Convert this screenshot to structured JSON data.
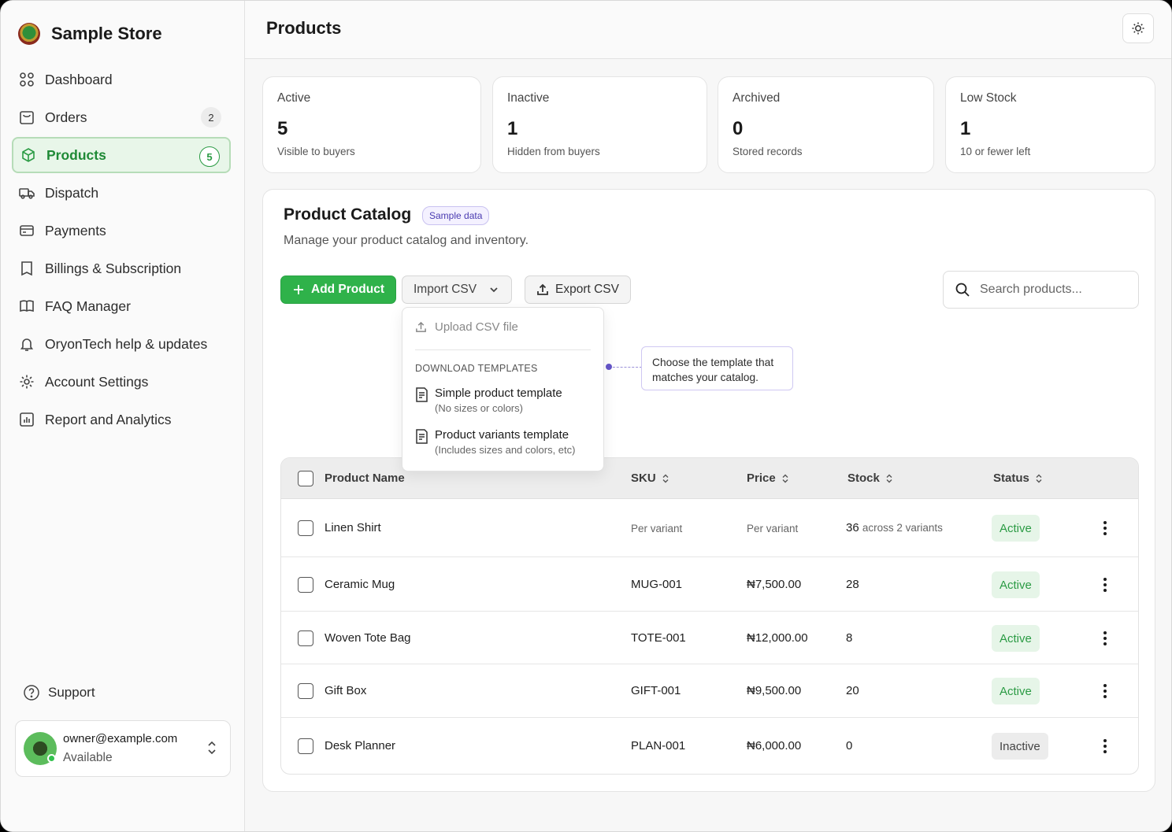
{
  "brand": {
    "name": "Sample Store"
  },
  "sidebar": {
    "items": [
      {
        "label": "Dashboard",
        "icon": "dashboard-icon"
      },
      {
        "label": "Orders",
        "icon": "orders-icon",
        "badge": "2"
      },
      {
        "label": "Products",
        "icon": "box-icon",
        "badge": "5",
        "active": true
      },
      {
        "label": "Dispatch",
        "icon": "truck-icon"
      },
      {
        "label": "Payments",
        "icon": "card-icon"
      },
      {
        "label": "Billings & Subscription",
        "icon": "bookmark-icon"
      },
      {
        "label": "FAQ Manager",
        "icon": "book-icon"
      },
      {
        "label": "OryonTech help & updates",
        "icon": "bell-icon"
      },
      {
        "label": "Account Settings",
        "icon": "gear-icon"
      },
      {
        "label": "Report and Analytics",
        "icon": "chart-icon"
      }
    ],
    "support": "Support",
    "user": {
      "email": "owner@example.com",
      "status": "Available"
    }
  },
  "header": {
    "title": "Products"
  },
  "stats": [
    {
      "label": "Active",
      "value": "5",
      "sub": "Visible to buyers"
    },
    {
      "label": "Inactive",
      "value": "1",
      "sub": "Hidden from buyers"
    },
    {
      "label": "Archived",
      "value": "0",
      "sub": "Stored records"
    },
    {
      "label": "Low Stock",
      "value": "1",
      "sub": "10 or fewer left"
    }
  ],
  "catalog": {
    "title": "Product Catalog",
    "badge": "Sample data",
    "description": "Manage your product catalog and inventory.",
    "add_button": "Add Product",
    "import_button": "Import CSV",
    "export_button": "Export CSV",
    "search_placeholder": "Search products..."
  },
  "import_menu": {
    "upload": "Upload CSV file",
    "section": "DOWNLOAD TEMPLATES",
    "templates": [
      {
        "title": "Simple product template",
        "sub": "(No sizes or colors)"
      },
      {
        "title": "Product variants template",
        "sub": "(Includes sizes and colors, etc)"
      }
    ],
    "tooltip": "Choose the template that matches your catalog."
  },
  "table": {
    "columns": [
      "Product Name",
      "SKU",
      "Price",
      "Stock",
      "Status"
    ],
    "rows": [
      {
        "name": "Linen Shirt",
        "sku": "Per variant",
        "price": "Per variant",
        "stock": "36",
        "stock_note": "across 2 variants",
        "status": "Active"
      },
      {
        "name": "Ceramic Mug",
        "sku": "MUG-001",
        "price": "₦7,500.00",
        "stock": "28",
        "stock_note": "",
        "status": "Active"
      },
      {
        "name": "Woven Tote Bag",
        "sku": "TOTE-001",
        "price": "₦12,000.00",
        "stock": "8",
        "stock_note": "",
        "status": "Active"
      },
      {
        "name": "Gift Box",
        "sku": "GIFT-001",
        "price": "₦9,500.00",
        "stock": "20",
        "stock_note": "",
        "status": "Active"
      },
      {
        "name": "Desk Planner",
        "sku": "PLAN-001",
        "price": "₦6,000.00",
        "stock": "0",
        "stock_note": "",
        "status": "Inactive"
      }
    ]
  },
  "colors": {
    "accent": "#2fb24a",
    "active_bg": "#e8f6e9",
    "tooltip_border": "#cfc8f2"
  }
}
